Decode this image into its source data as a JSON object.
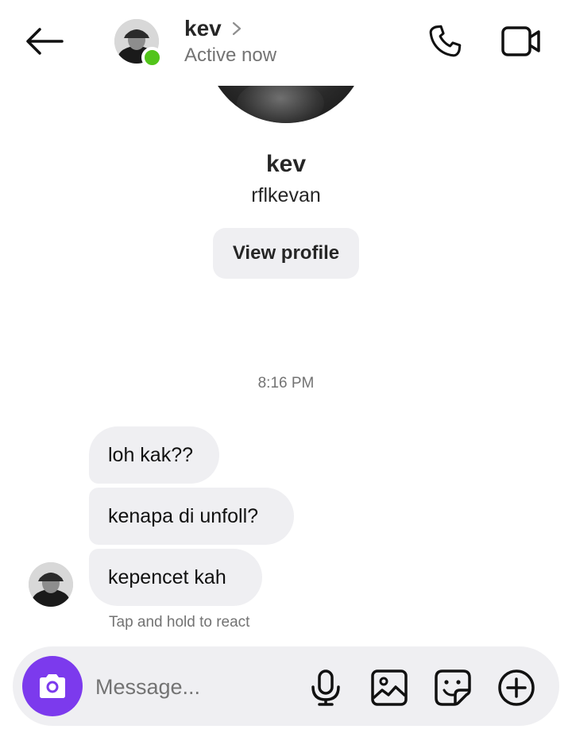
{
  "header": {
    "name": "kev",
    "status": "Active now",
    "status_color": "#52c41a"
  },
  "profile": {
    "name": "kev",
    "username": "rflkevan",
    "view_profile_label": "View profile"
  },
  "conversation": {
    "timestamp": "8:16 PM",
    "messages": [
      {
        "text": "loh kak??",
        "from": "kev"
      },
      {
        "text": "kenapa di unfoll?",
        "from": "kev"
      },
      {
        "text": "kepencet kah",
        "from": "kev"
      }
    ],
    "react_hint": "Tap and hold to react"
  },
  "composer": {
    "placeholder": "Message...",
    "camera_color": "#7c3aed"
  },
  "icons": [
    "back-arrow-icon",
    "chevron-right-icon",
    "phone-icon",
    "video-camera-icon",
    "camera-icon",
    "microphone-icon",
    "gallery-icon",
    "sticker-icon",
    "plus-circle-icon"
  ]
}
